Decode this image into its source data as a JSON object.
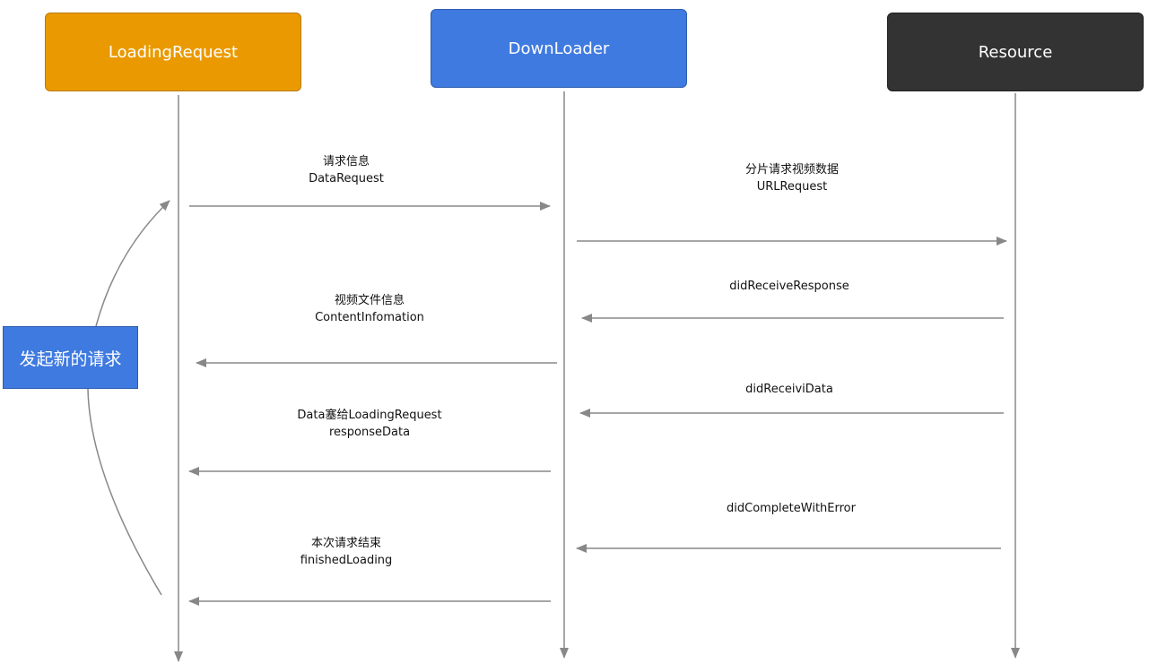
{
  "actors": {
    "loading_request": "LoadingRequest",
    "downloader": "DownLoader",
    "resource": "Resource"
  },
  "messages": [
    {
      "line1": "请求信息",
      "line2": "DataRequest"
    },
    {
      "line1": "分片请求视频数据",
      "line2": "URLRequest"
    },
    {
      "line1": "didReceiveResponse",
      "line2": ""
    },
    {
      "line1": "视频文件信息",
      "line2": "ContentInfomation"
    },
    {
      "line1": "didReceiviData",
      "line2": ""
    },
    {
      "line1": "Data塞给LoadingRequest",
      "line2": "responseData"
    },
    {
      "line1": "didCompleteWithError",
      "line2": ""
    },
    {
      "line1": "本次请求结束",
      "line2": "finishedLoading"
    }
  ],
  "note": {
    "label": "发起新的请求"
  },
  "colors": {
    "loading_request": "#ea9a00",
    "downloader": "#3f7ae0",
    "resource": "#333333",
    "note": "#3f7ae0",
    "arrows": "#888888"
  }
}
